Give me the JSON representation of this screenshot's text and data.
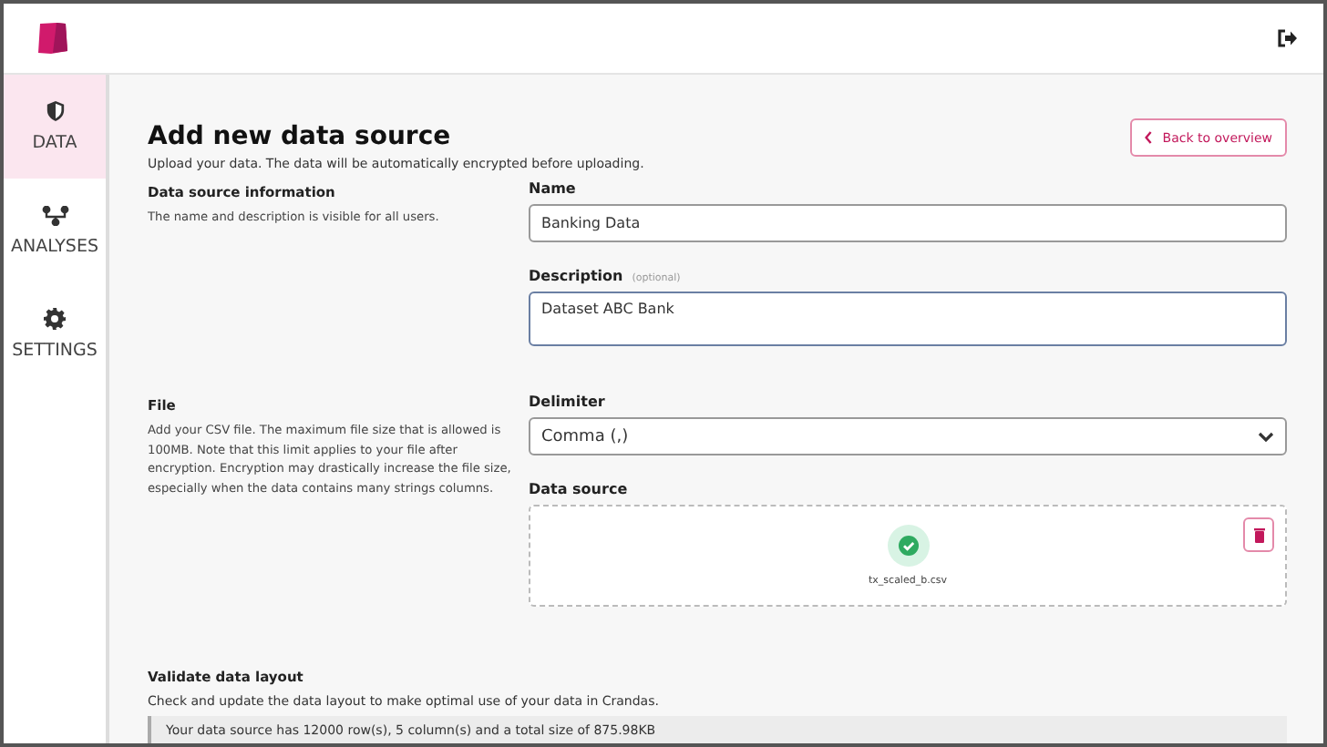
{
  "sidebar": {
    "items": [
      {
        "label": "DATA",
        "selected": true
      },
      {
        "label": "ANALYSES",
        "selected": false
      },
      {
        "label": "SETTINGS",
        "selected": false
      }
    ]
  },
  "page": {
    "title": "Add new data source",
    "subtitle": "Upload your data. The data will be automatically encrypted before uploading.",
    "back_button": "Back to overview"
  },
  "sections": [
    {
      "title": "Data source information",
      "description": "The name and description is visible for all users.",
      "fields": [
        {
          "kind": "input",
          "label": "Name",
          "value": "Banking Data"
        },
        {
          "kind": "textarea",
          "label": "Description",
          "hint": "(optional)",
          "value": "Dataset ABC Bank"
        }
      ]
    },
    {
      "title": "File",
      "description": "Add your CSV file. The maximum file size that is allowed is 100MB. Note that this limit applies to your file after encryption. Encryption may drastically increase the file size, especially when the data contains many strings columns.",
      "fields": [
        {
          "kind": "select",
          "label": "Delimiter",
          "value": "Comma (,)"
        },
        {
          "kind": "upload",
          "label": "Data source",
          "file_name": "tx_scaled_b.csv"
        }
      ]
    }
  ],
  "validate": {
    "title": "Validate data layout",
    "description": "Check and update the data layout to make optimal use of your data in Crandas.",
    "info": "Your data source has 12000 row(s), 5 column(s) and a total size of 875.98KB"
  }
}
